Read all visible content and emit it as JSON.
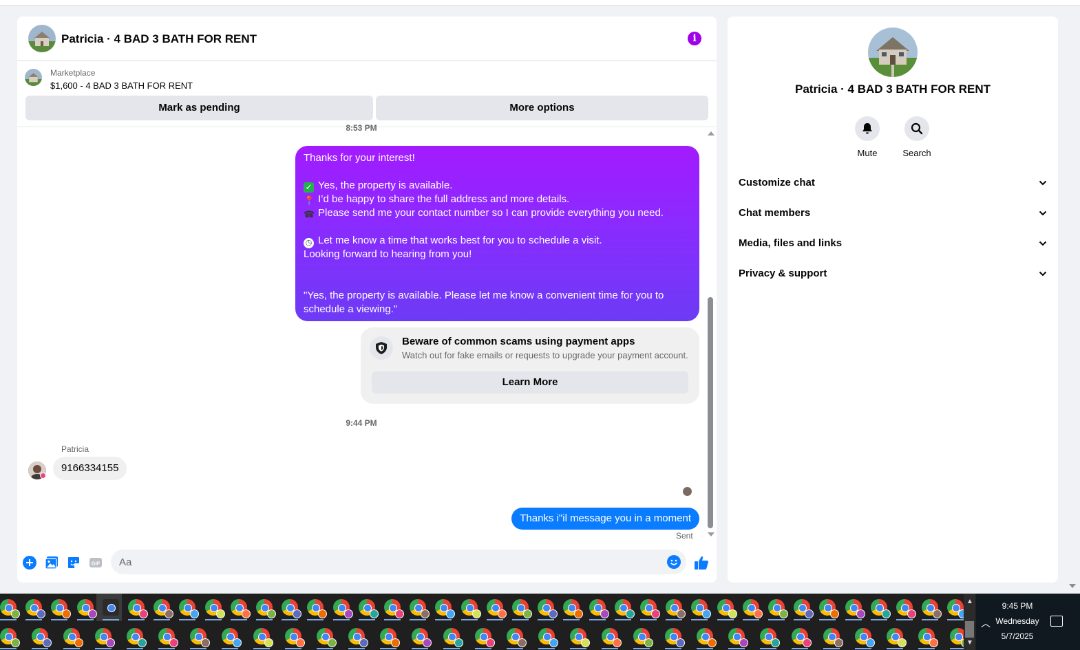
{
  "chat": {
    "header_title": "Patricia · 4 BAD 3 BATH FOR RENT",
    "marketplace_label": "Marketplace",
    "listing": "$1,600 - 4 BAD 3 BATH FOR RENT",
    "mark_pending_label": "Mark as pending",
    "more_options_label": "More options",
    "timestamp_1": "8:53 PM",
    "timestamp_2": "9:44 PM",
    "outgoing_message": {
      "line1": "Thanks for your interest!",
      "line2": "Yes, the property is available.",
      "line3": "I’d be happy to share the full address and more details.",
      "line4": "Please send me your contact number so I can provide everything you need.",
      "line5": "Let me know a time that works best for you to schedule a visit.",
      "line6": "Looking forward to hearing from you!",
      "line7": "\"Yes, the property is available. Please let me know a convenient time for you to schedule a viewing.\""
    },
    "scam_notice": {
      "title": "Beware of common scams using payment apps",
      "description": "Watch out for fake emails or requests to upgrade your payment account.",
      "button": "Learn More"
    },
    "incoming": {
      "sender": "Patricia",
      "text": "9166334155"
    },
    "sent_message": "Thanks i\"il message you in a moment",
    "sent_status": "Sent",
    "composer_placeholder": "Aa"
  },
  "info_panel": {
    "name": "Patricia · 4 BAD 3 BATH FOR RENT",
    "actions": {
      "mute": "Mute",
      "search": "Search"
    },
    "sections": [
      "Customize chat",
      "Chat members",
      "Media, files and links",
      "Privacy & support"
    ]
  },
  "taskbar": {
    "time": "9:45 PM",
    "day": "Wednesday",
    "date": "5/7/2025"
  },
  "colors": {
    "brand_purple": "#a000e8",
    "messenger_blue": "#0a7cff"
  }
}
